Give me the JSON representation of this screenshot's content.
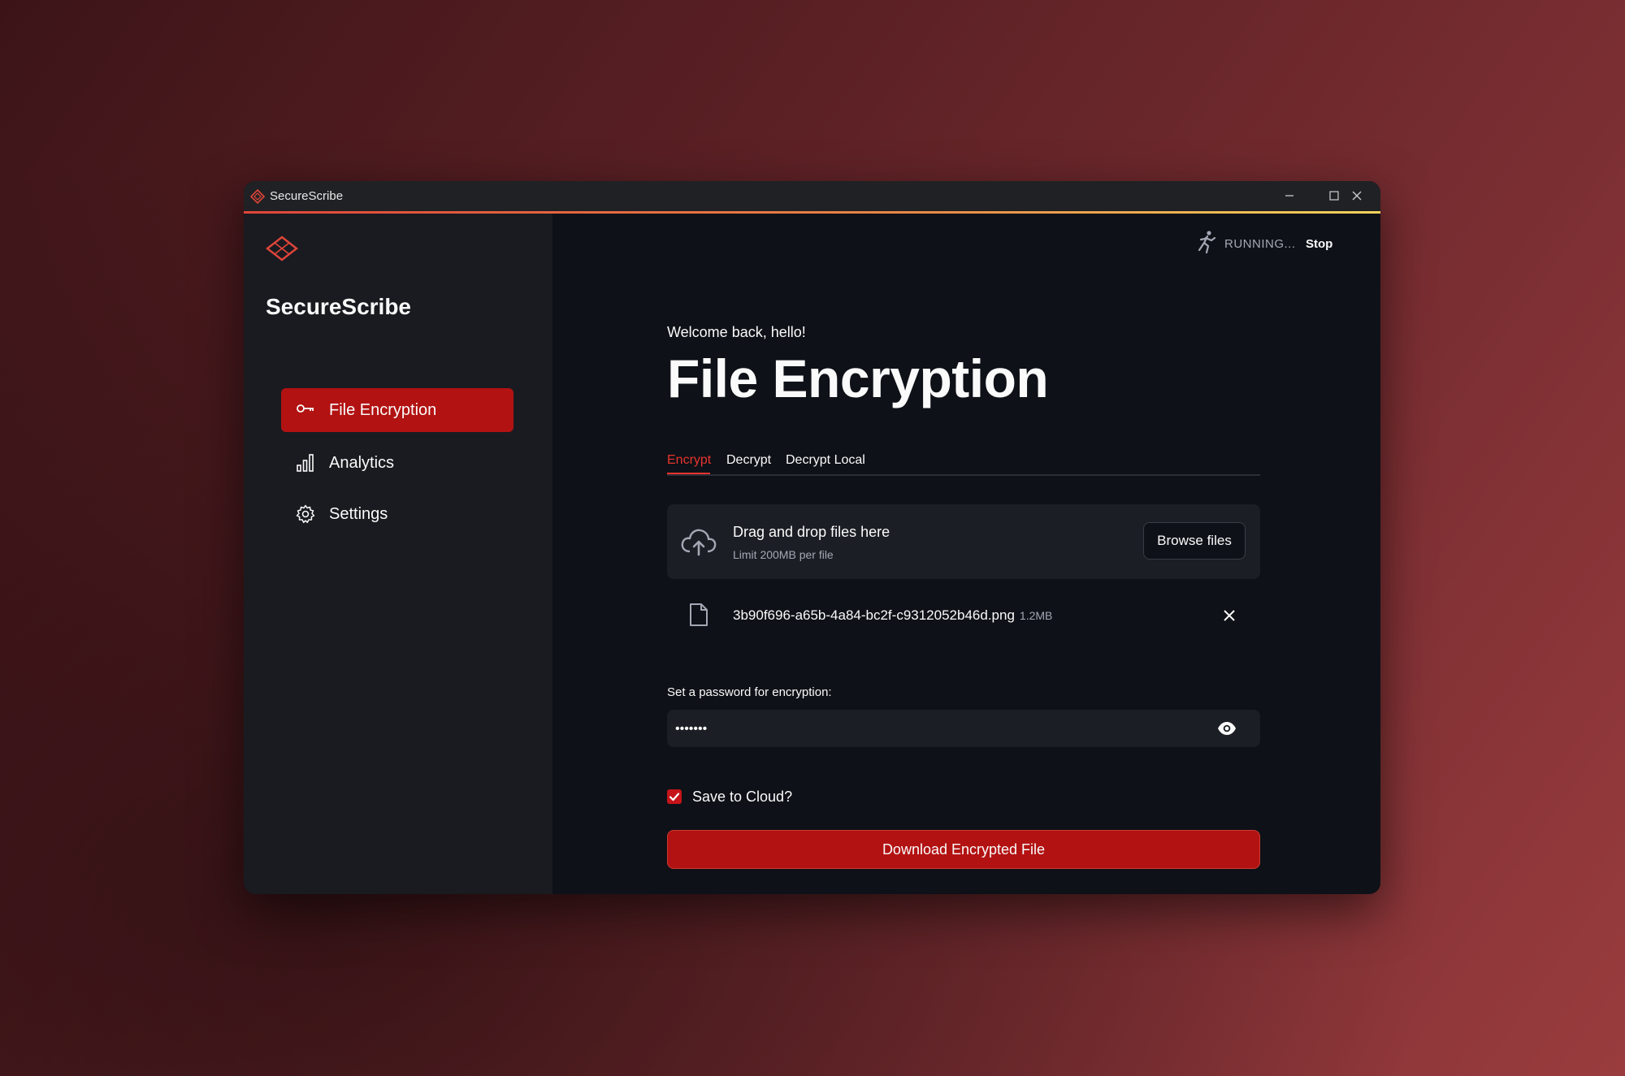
{
  "window": {
    "title": "SecureScribe",
    "controls": [
      "minimize-icon",
      "maximize-icon",
      "close-icon"
    ]
  },
  "sidebar": {
    "brand": "SecureScribe",
    "items": [
      {
        "label": "File Encryption",
        "icon": "key-icon",
        "active": true
      },
      {
        "label": "Analytics",
        "icon": "bar-chart-icon",
        "active": false
      },
      {
        "label": "Settings",
        "icon": "gear-icon",
        "active": false
      }
    ]
  },
  "status": {
    "text": "RUNNING...",
    "stop_label": "Stop"
  },
  "main": {
    "welcome": "Welcome back, hello!",
    "title": "File Encryption",
    "tabs": [
      {
        "label": "Encrypt",
        "active": true
      },
      {
        "label": "Decrypt",
        "active": false
      },
      {
        "label": "Decrypt Local",
        "active": false
      }
    ],
    "uploader": {
      "main_text": "Drag and drop files here",
      "sub_text": "Limit 200MB per file",
      "browse_label": "Browse files"
    },
    "file": {
      "name": "3b90f696-a65b-4a84-bc2f-c9312052b46d.png",
      "size": "1.2MB"
    },
    "password": {
      "label": "Set a password for encryption:",
      "value": "•••••••"
    },
    "save_cloud": {
      "label": "Save to Cloud?",
      "checked": true
    },
    "download_label": "Download Encrypted File"
  },
  "colors": {
    "accent": "#b31212",
    "accent_text": "#e8352e",
    "background": "#0e1117",
    "sidebar": "#1a1b20"
  }
}
